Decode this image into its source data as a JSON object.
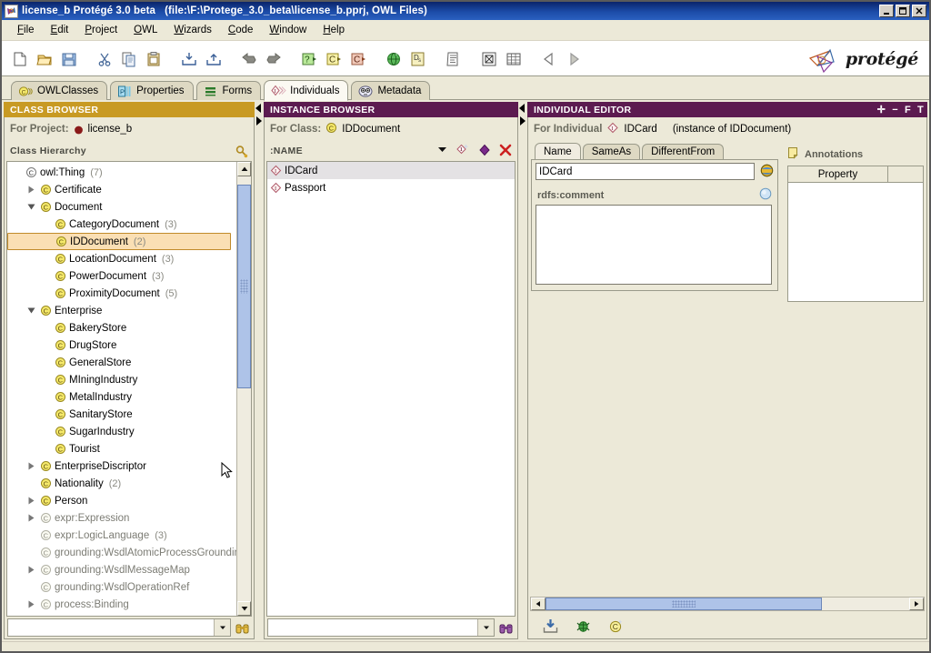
{
  "window": {
    "title": "license_b  Protégé 3.0 beta",
    "file_info": "(file:\\F:\\Protege_3.0_beta\\license_b.pprj, OWL Files)",
    "app_icon": "protege-logo-icon",
    "buttons": [
      {
        "name": "minimize",
        "glyph": "_"
      },
      {
        "name": "maximize",
        "glyph": "□"
      },
      {
        "name": "close",
        "glyph": "✕"
      }
    ]
  },
  "menubar": {
    "items": [
      {
        "label": "File",
        "mnemonic": "F"
      },
      {
        "label": "Edit",
        "mnemonic": "E"
      },
      {
        "label": "Project",
        "mnemonic": "P"
      },
      {
        "label": "OWL",
        "mnemonic": "O"
      },
      {
        "label": "Wizards",
        "mnemonic": "W"
      },
      {
        "label": "Code",
        "mnemonic": "C"
      },
      {
        "label": "Window",
        "mnemonic": "W"
      },
      {
        "label": "Help",
        "mnemonic": "H"
      }
    ]
  },
  "toolbar": {
    "items": [
      {
        "name": "new-project-icon"
      },
      {
        "name": "open-project-icon"
      },
      {
        "name": "save-project-icon"
      },
      {
        "name": "cut-icon"
      },
      {
        "name": "copy-icon"
      },
      {
        "name": "paste-icon"
      },
      {
        "name": "import-icon"
      },
      {
        "name": "export-icon"
      },
      {
        "name": "undo-icon"
      },
      {
        "name": "redo-icon"
      },
      {
        "name": "create-query-icon"
      },
      {
        "name": "create-class-icon"
      },
      {
        "name": "create-subclass-icon"
      },
      {
        "name": "ontology-globe-icon"
      },
      {
        "name": "documentation-icon"
      },
      {
        "name": "notes-icon"
      },
      {
        "name": "jess-icon"
      },
      {
        "name": "table-icon"
      },
      {
        "name": "back-icon"
      },
      {
        "name": "forward-icon"
      }
    ],
    "logo_text": "protégé",
    "logo_icon": "protege-trefoil-icon"
  },
  "tabs": [
    {
      "label": "OWLClasses",
      "icon": "owl-class-icon",
      "active": false
    },
    {
      "label": "Properties",
      "icon": "property-icon",
      "active": false
    },
    {
      "label": "Forms",
      "icon": "forms-icon",
      "active": false
    },
    {
      "label": "Individuals",
      "icon": "individual-icon",
      "active": true
    },
    {
      "label": "Metadata",
      "icon": "metadata-icon",
      "active": false
    }
  ],
  "class_browser": {
    "header": "CLASS BROWSER",
    "for_project_label": "For Project:",
    "project_name": "license_b",
    "hierarchy_label": "Class Hierarchy",
    "search_tool_icon": "find-class-icon",
    "tree": [
      {
        "label": "owl:Thing",
        "count": "(7)",
        "indent": 0,
        "twisty": "none",
        "icon": "owl-thing-icon",
        "faded": false,
        "selected": false
      },
      {
        "label": "Certificate",
        "count": "",
        "indent": 1,
        "twisty": "collapsed",
        "icon": "owl-class-icon",
        "faded": false,
        "selected": false
      },
      {
        "label": "Document",
        "count": "",
        "indent": 1,
        "twisty": "expanded",
        "icon": "owl-class-icon",
        "faded": false,
        "selected": false
      },
      {
        "label": "CategoryDocument",
        "count": "(3)",
        "indent": 2,
        "twisty": "none",
        "icon": "owl-class-icon",
        "faded": false,
        "selected": false
      },
      {
        "label": "IDDocument",
        "count": "(2)",
        "indent": 2,
        "twisty": "none",
        "icon": "owl-class-icon",
        "faded": false,
        "selected": true
      },
      {
        "label": "LocationDocument",
        "count": "(3)",
        "indent": 2,
        "twisty": "none",
        "icon": "owl-class-icon",
        "faded": false,
        "selected": false
      },
      {
        "label": "PowerDocument",
        "count": "(3)",
        "indent": 2,
        "twisty": "none",
        "icon": "owl-class-icon",
        "faded": false,
        "selected": false
      },
      {
        "label": "ProximityDocument",
        "count": "(5)",
        "indent": 2,
        "twisty": "none",
        "icon": "owl-class-icon",
        "faded": false,
        "selected": false
      },
      {
        "label": "Enterprise",
        "count": "",
        "indent": 1,
        "twisty": "expanded",
        "icon": "owl-class-icon",
        "faded": false,
        "selected": false
      },
      {
        "label": "BakeryStore",
        "count": "",
        "indent": 2,
        "twisty": "none",
        "icon": "owl-class-icon",
        "faded": false,
        "selected": false
      },
      {
        "label": "DrugStore",
        "count": "",
        "indent": 2,
        "twisty": "none",
        "icon": "owl-class-icon",
        "faded": false,
        "selected": false
      },
      {
        "label": "GeneralStore",
        "count": "",
        "indent": 2,
        "twisty": "none",
        "icon": "owl-class-icon",
        "faded": false,
        "selected": false
      },
      {
        "label": "MIningIndustry",
        "count": "",
        "indent": 2,
        "twisty": "none",
        "icon": "owl-class-icon",
        "faded": false,
        "selected": false
      },
      {
        "label": "MetalIndustry",
        "count": "",
        "indent": 2,
        "twisty": "none",
        "icon": "owl-class-icon",
        "faded": false,
        "selected": false
      },
      {
        "label": "SanitaryStore",
        "count": "",
        "indent": 2,
        "twisty": "none",
        "icon": "owl-class-icon",
        "faded": false,
        "selected": false
      },
      {
        "label": "SugarIndustry",
        "count": "",
        "indent": 2,
        "twisty": "none",
        "icon": "owl-class-icon",
        "faded": false,
        "selected": false
      },
      {
        "label": "Tourist",
        "count": "",
        "indent": 2,
        "twisty": "none",
        "icon": "owl-class-icon",
        "faded": false,
        "selected": false
      },
      {
        "label": "EnterpriseDiscriptor",
        "count": "",
        "indent": 1,
        "twisty": "collapsed",
        "icon": "owl-class-icon",
        "faded": false,
        "selected": false
      },
      {
        "label": "Nationality",
        "count": "(2)",
        "indent": 1,
        "twisty": "none",
        "icon": "owl-class-icon",
        "faded": false,
        "selected": false
      },
      {
        "label": "Person",
        "count": "",
        "indent": 1,
        "twisty": "collapsed",
        "icon": "owl-class-icon",
        "faded": false,
        "selected": false
      },
      {
        "label": "expr:Expression",
        "count": "",
        "indent": 1,
        "twisty": "collapsed",
        "icon": "owl-class-imported-icon",
        "faded": true,
        "selected": false
      },
      {
        "label": "expr:LogicLanguage",
        "count": "(3)",
        "indent": 1,
        "twisty": "none",
        "icon": "owl-class-imported-icon",
        "faded": true,
        "selected": false
      },
      {
        "label": "grounding:WsdlAtomicProcessGrounding",
        "count": "",
        "indent": 1,
        "twisty": "none",
        "icon": "owl-class-imported-icon",
        "faded": true,
        "selected": false
      },
      {
        "label": "grounding:WsdlMessageMap",
        "count": "",
        "indent": 1,
        "twisty": "collapsed",
        "icon": "owl-class-imported-icon",
        "faded": true,
        "selected": false
      },
      {
        "label": "grounding:WsdlOperationRef",
        "count": "",
        "indent": 1,
        "twisty": "none",
        "icon": "owl-class-imported-icon",
        "faded": true,
        "selected": false
      },
      {
        "label": "process:Binding",
        "count": "",
        "indent": 1,
        "twisty": "collapsed",
        "icon": "owl-class-imported-icon",
        "faded": true,
        "selected": false
      }
    ],
    "search_value": "",
    "search_icon": "binoculars-icon"
  },
  "instance_browser": {
    "header": "INSTANCE BROWSER",
    "for_class_label": "For Class:",
    "class_name": "IDDocument",
    "class_icon": "owl-class-icon",
    "column_header": ":NAME",
    "tools": [
      {
        "name": "sort-dropdown-icon"
      },
      {
        "name": "create-instance-icon"
      },
      {
        "name": "duplicate-instance-icon"
      },
      {
        "name": "delete-instance-icon"
      }
    ],
    "instances": [
      {
        "label": "IDCard",
        "icon": "individual-icon",
        "selected": true
      },
      {
        "label": "Passport",
        "icon": "individual-icon",
        "selected": false
      }
    ],
    "search_value": "",
    "search_icon": "binoculars-purple-icon"
  },
  "individual_editor": {
    "header": "INDIVIDUAL EDITOR",
    "header_controls": [
      {
        "name": "add-slot-button",
        "glyph": "✛"
      },
      {
        "name": "remove-slot-button",
        "glyph": "−"
      },
      {
        "name": "form-button",
        "glyph": "F"
      },
      {
        "name": "text-button",
        "glyph": "T"
      }
    ],
    "for_individual_label": "For Individual",
    "individual_name": "IDCard",
    "individual_icon": "individual-icon",
    "instance_of": "(instance of IDDocument)",
    "tabs": [
      {
        "label": "Name",
        "active": true
      },
      {
        "label": "SameAs",
        "active": false
      },
      {
        "label": "DifferentFrom",
        "active": false
      }
    ],
    "name_value": "IDCard",
    "name_icon": "globe-icon",
    "comment_label": "rdfs:comment",
    "comment_icon": "language-circle-icon",
    "comment_value": "",
    "annotations": {
      "title": "Annotations",
      "icon": "annotation-note-icon",
      "columns": [
        "Property",
        ""
      ],
      "rows": []
    },
    "bottom_buttons": [
      {
        "name": "save-instance-icon"
      },
      {
        "name": "jess-bug-icon"
      },
      {
        "name": "create-instance-icon"
      }
    ]
  },
  "colors": {
    "class_browser_header": "#c89a23",
    "instance_browser_header": "#5c1b50",
    "individual_editor_header": "#5c1b50",
    "titlebar": "#0a246a",
    "selection_tree": "#fadfb4",
    "selection_list": "#e4e2e4",
    "panel_bg": "#ece9d8",
    "scrollbar_thumb": "#aec3e8"
  }
}
